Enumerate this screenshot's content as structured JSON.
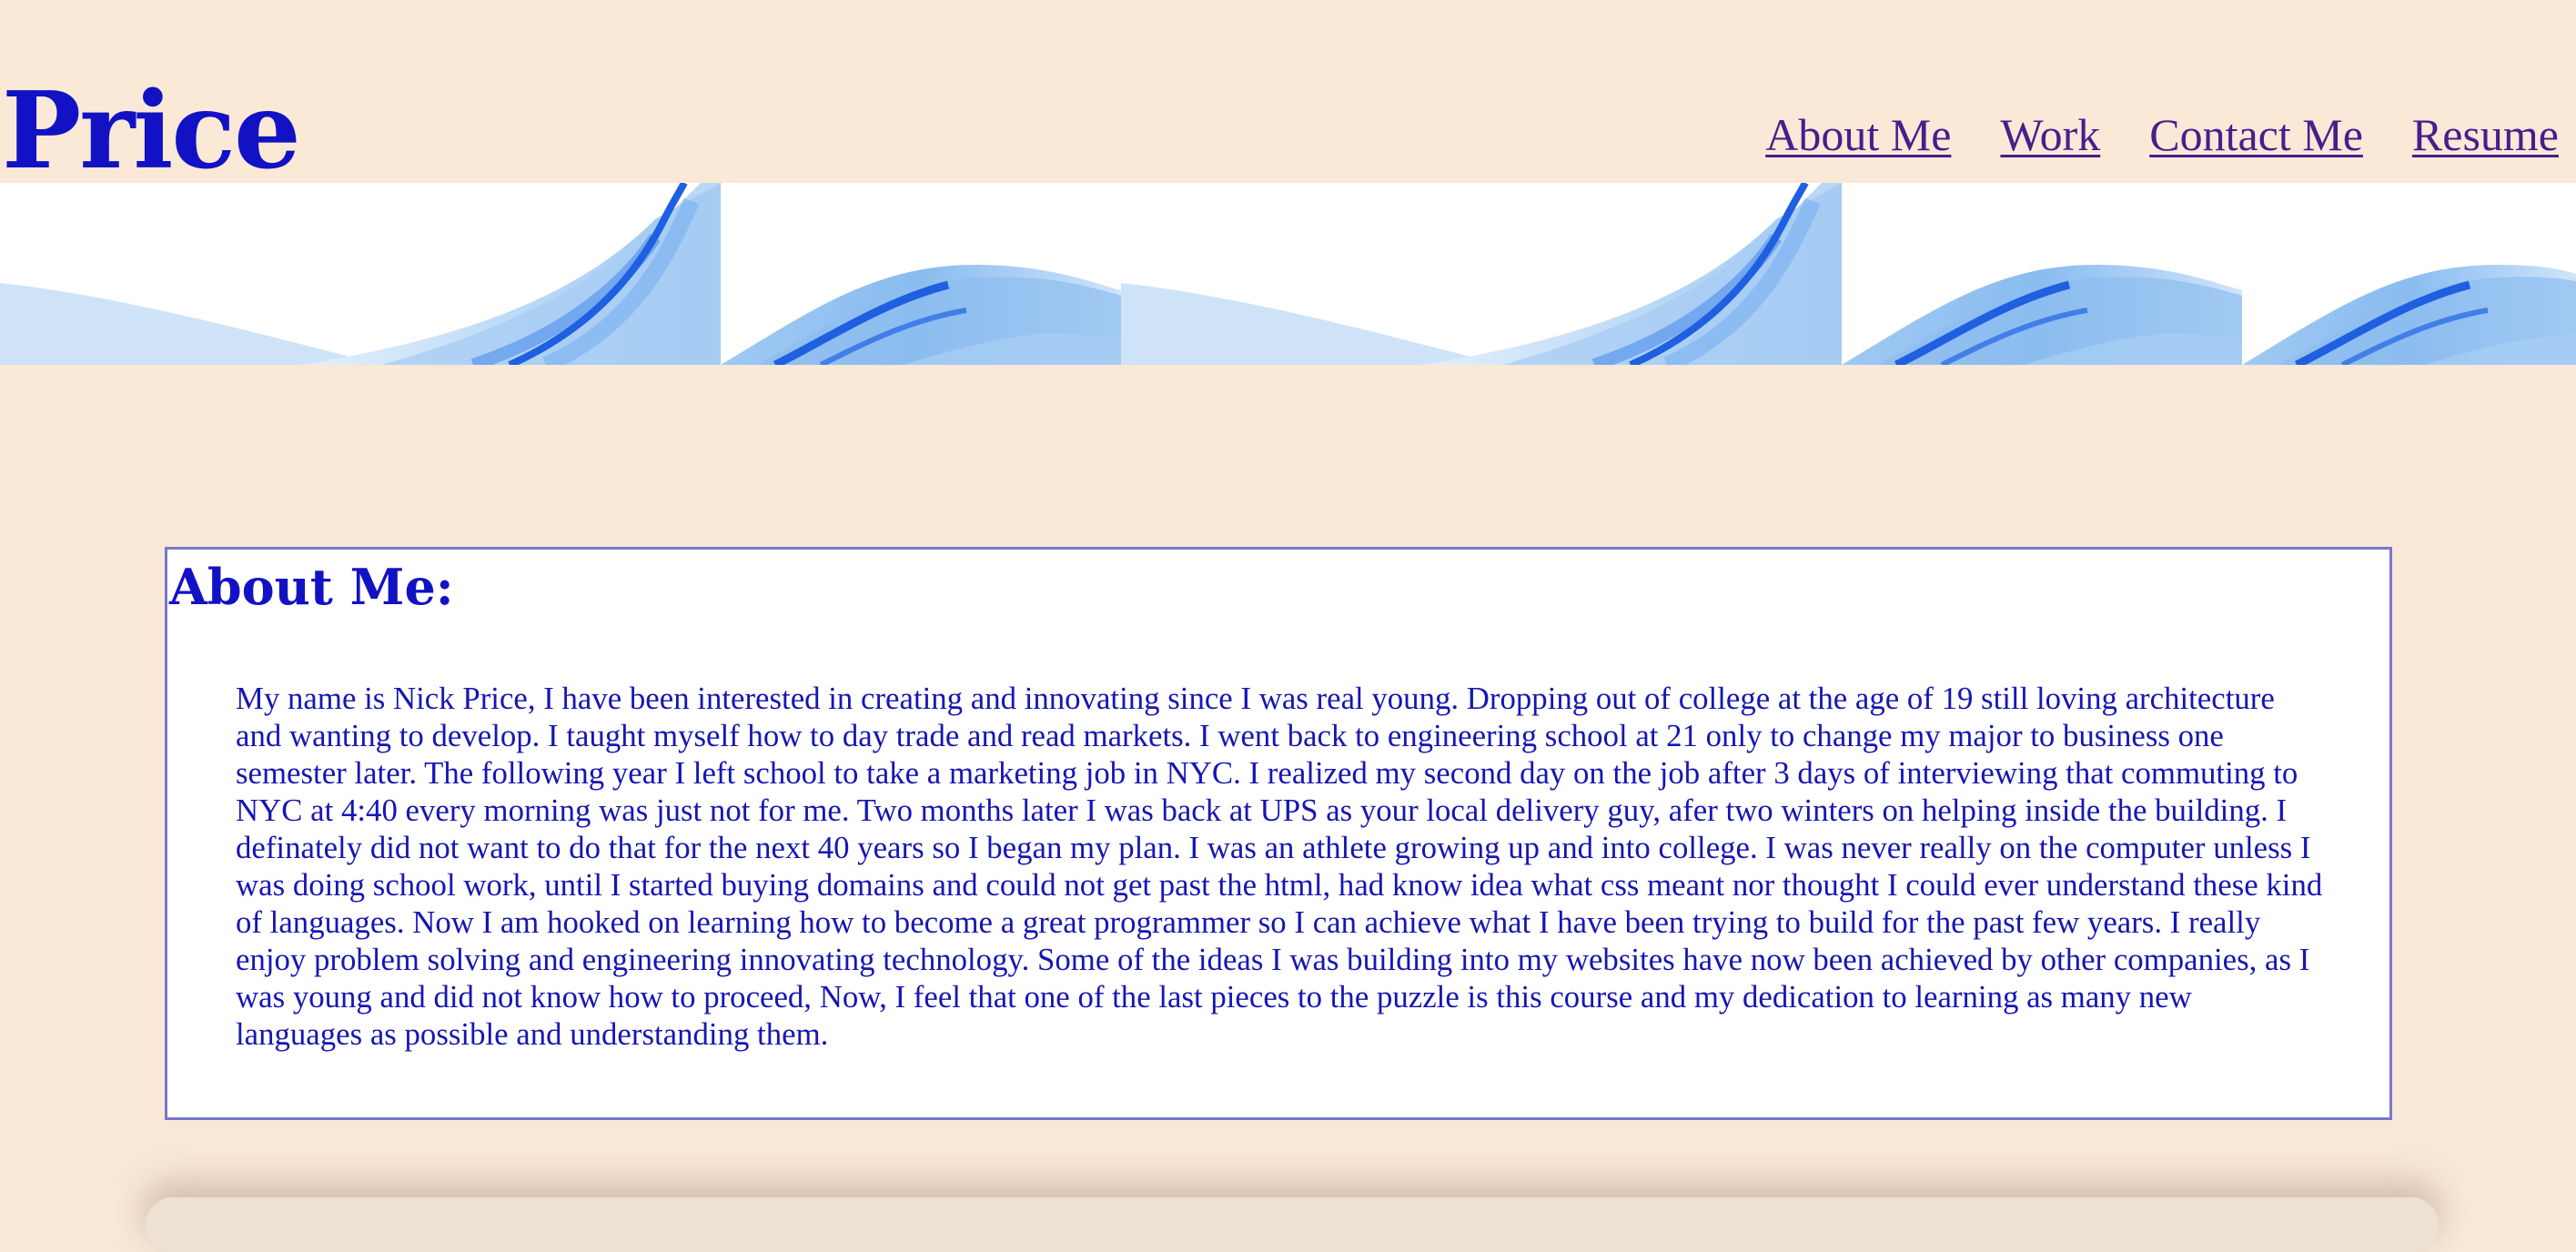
{
  "header": {
    "site_title": "Price",
    "nav": [
      {
        "label": "About Me"
      },
      {
        "label": "Work"
      },
      {
        "label": "Contact Me"
      },
      {
        "label": "Resume"
      }
    ]
  },
  "banner": {
    "icon": "blue-wave-image"
  },
  "about": {
    "heading": "About Me:",
    "body": "My name is Nick Price, I have been interested in creating and innovating since I was real young. Dropping out of college at the age of 19 still loving architecture and wanting to develop. I taught myself how to day trade and read markets. I went back to engineering school at 21 only to change my major to business one semester later. The following year I left school to take a marketing job in NYC. I realized my second day on the job after 3 days of interviewing that commuting to NYC at 4:40 every morning was just not for me. Two months later I was back at UPS as your local delivery guy, afer two winters on helping inside the building. I definately did not want to do that for the next 40 years so I began my plan. I was an athlete growing up and into college. I was never really on the computer unless I was doing school work, until I started buying domains and could not get past the html, had know idea what css meant nor thought I could ever understand these kind of languages. Now I am hooked on learning how to become a great programmer so I can achieve what I have been trying to build for the past few years. I really enjoy problem solving and engineering innovating technology. Some of the ideas I was building into my websites have now been achieved by other companies, as I was young and did not know how to proceed, Now, I feel that one of the last pieces to the puzzle is this course and my dedication to learning as many new languages as possible and understanding them."
  },
  "colors": {
    "page_background": "#fae9d7",
    "title": "#1212c4",
    "nav_link": "#4a1d8c",
    "body_text": "#1616b4",
    "box_border": "#7777cf",
    "wave_light": "#bcdcf7",
    "wave_mid": "#7fb5ef",
    "wave_dark": "#1f5fe0"
  }
}
